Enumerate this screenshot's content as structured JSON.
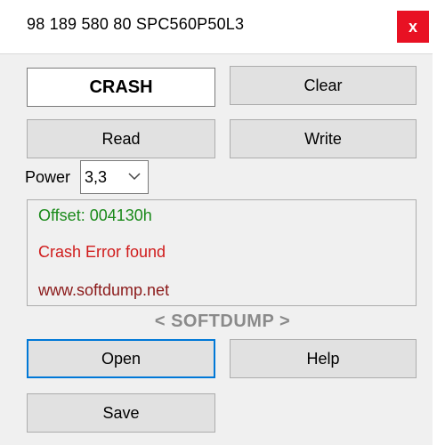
{
  "window": {
    "title": "98 189 580 80 SPC560P50L3",
    "close_label": "x"
  },
  "status": {
    "text": "CRASH"
  },
  "buttons": {
    "clear": "Clear",
    "read": "Read",
    "write": "Write",
    "open": "Open",
    "help": "Help",
    "save": "Save"
  },
  "power": {
    "label": "Power",
    "selected": "3,3"
  },
  "log": {
    "lines": [
      {
        "text": "Offset: 004130h",
        "color": "#1a8a1a"
      },
      {
        "text": "Crash Error found",
        "color": "#d01c1c"
      },
      {
        "text": "www.softdump.net",
        "color": "#8b1a1a"
      }
    ]
  },
  "brand": {
    "text": "< SOFTDUMP >"
  },
  "colors": {
    "close_bg": "#e81123",
    "focus_border": "#0078d7"
  }
}
